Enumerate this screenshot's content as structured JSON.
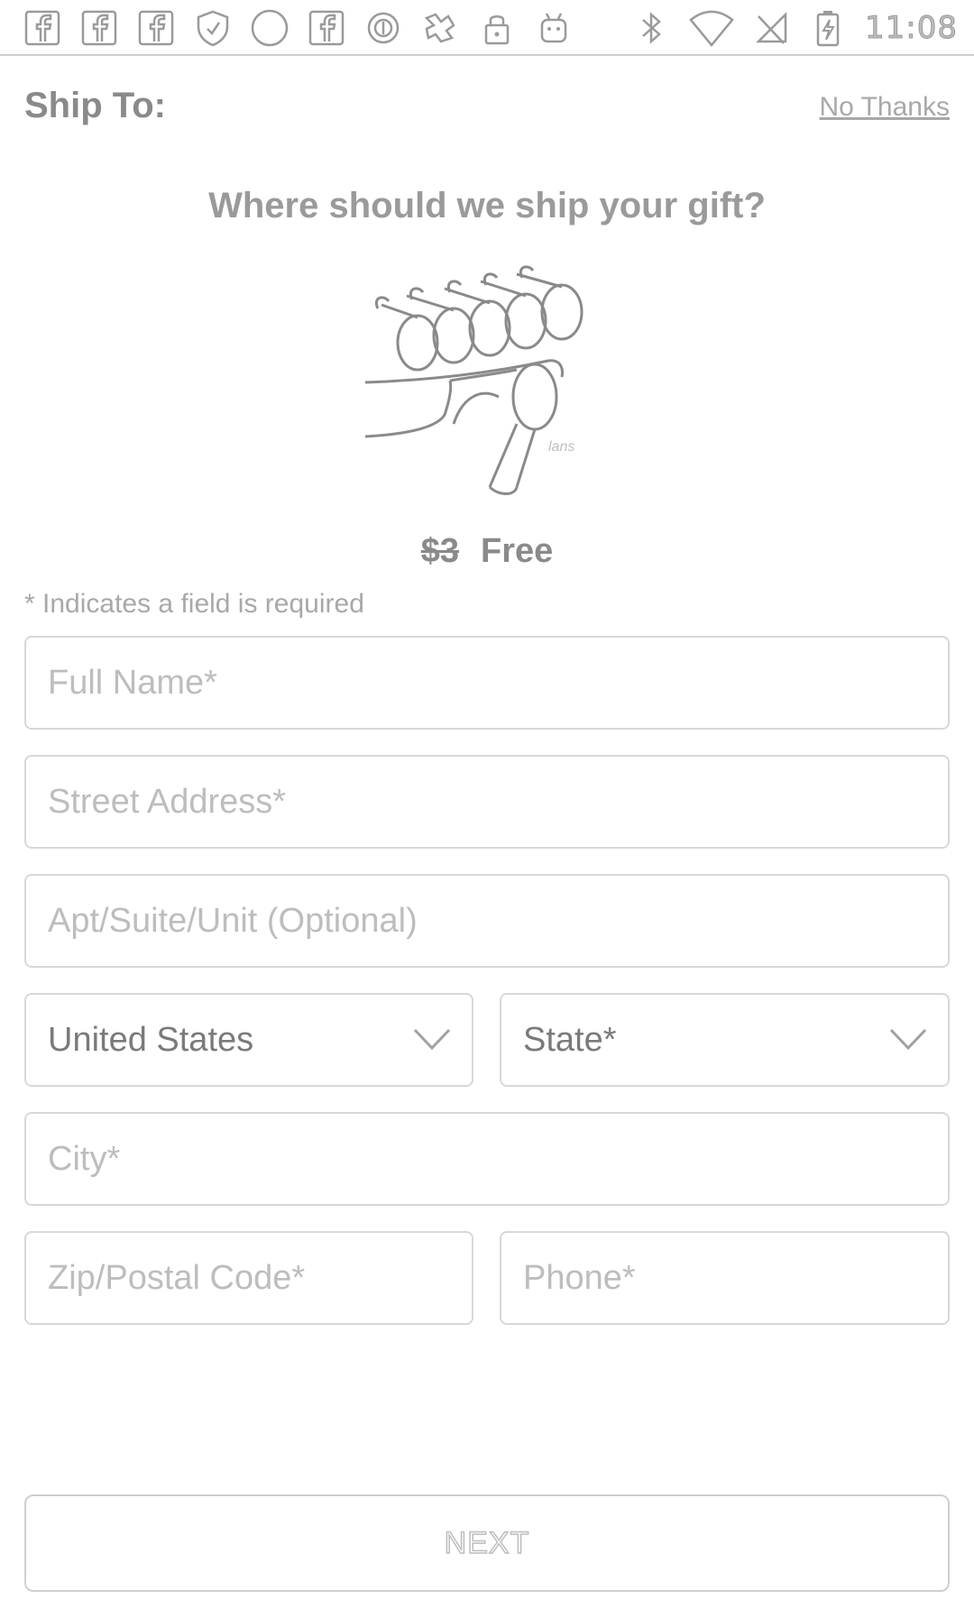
{
  "status_bar": {
    "time": "11:08",
    "left_icons": [
      "facebook-icon",
      "facebook-icon",
      "facebook-icon",
      "shield-icon",
      "circle-icon",
      "facebook-icon",
      "record-icon",
      "puzzle-icon",
      "lock-icon",
      "android-icon"
    ],
    "right_icons": [
      "bluetooth-icon",
      "wifi-icon",
      "no-signal-icon",
      "battery-charging-icon"
    ]
  },
  "header": {
    "title": "Ship To:",
    "no_thanks": "No Thanks"
  },
  "question": "Where should we ship your gift?",
  "product": {
    "image_icon": "glasses-clips-product-image",
    "old_price": "$3",
    "new_price": "Free"
  },
  "required_note": "* Indicates a field is required",
  "form": {
    "full_name_placeholder": "Full Name*",
    "street_placeholder": "Street Address*",
    "apt_placeholder": "Apt/Suite/Unit (Optional)",
    "country_value": "United States",
    "state_value": "State*",
    "city_placeholder": "City*",
    "zip_placeholder": "Zip/Postal Code*",
    "phone_placeholder": "Phone*"
  },
  "next_button": "NEXT",
  "colors": {
    "border": "#d8d8d8",
    "placeholder": "#bdbdbd",
    "text": "#8a8a8a"
  }
}
